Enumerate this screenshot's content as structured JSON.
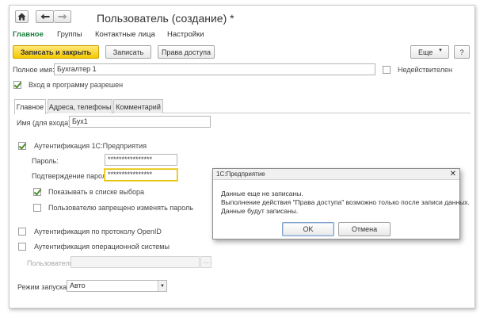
{
  "window": {
    "title": "Пользователь (создание) *"
  },
  "nav": {
    "tabs": [
      {
        "label": "Главное",
        "active": true
      },
      {
        "label": "Группы"
      },
      {
        "label": "Контактные лица"
      },
      {
        "label": "Настройки"
      }
    ]
  },
  "toolbar": {
    "save_close": "Записать и закрыть",
    "save": "Записать",
    "access_rights": "Права доступа",
    "more": "Еще",
    "help": "?"
  },
  "form": {
    "full_name_label": "Полное имя:",
    "full_name_value": "Бухгалтер 1",
    "inactive_label": "Недействителен",
    "login_allowed_label": "Вход в программу разрешен",
    "inner_tabs": [
      "Главное",
      "Адреса, телефоны",
      "Комментарий"
    ],
    "login_name_label": "Имя (для входа):",
    "login_name_value": "Бух1",
    "auth_1c_label": "Аутентификация 1С:Предприятия",
    "password_label": "Пароль:",
    "password_value": "****************",
    "password_confirm_label": "Подтверждение пароля:",
    "password_confirm_value": "****************",
    "show_in_list_label": "Показывать в списке выбора",
    "deny_change_password_label": "Пользователю запрещено изменять пароль",
    "openid_label": "Аутентификация по протоколу OpenID",
    "os_auth_label": "Аутентификация операционной системы",
    "os_user_label": "Пользователь:",
    "os_user_button": "...",
    "launch_mode_label": "Режим запуска:",
    "launch_mode_value": "Авто"
  },
  "dialog": {
    "title": "1С:Предприятие",
    "lines": [
      "Данные еще не записаны.",
      "Выполнение действия \"Права доступа\" возможно только после записи данных.",
      "Данные будут записаны."
    ],
    "ok": "OK",
    "cancel": "Отмена"
  },
  "colors": {
    "accent_green": "#1d7d3e",
    "primary_button": "#f5c800",
    "check_green": "#4a8f2a"
  }
}
